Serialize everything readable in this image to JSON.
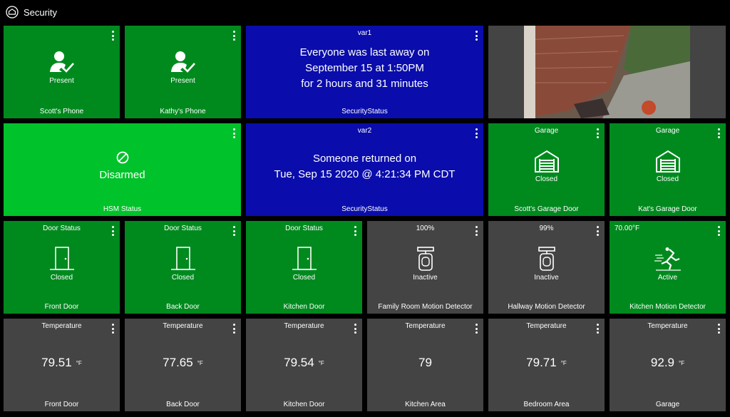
{
  "header": {
    "title": "Security",
    "icon": "home-icon"
  },
  "colors": {
    "green": "#008a1e",
    "light_green": "#00c22a",
    "blue": "#0a0dab",
    "gray": "#444444",
    "background": "#000000"
  },
  "tiles": {
    "scotts_phone": {
      "state": "Present",
      "label": "Scott's Phone",
      "icon": "person-check-icon"
    },
    "kathys_phone": {
      "state": "Present",
      "label": "Kathy's Phone",
      "icon": "person-check-icon"
    },
    "var1": {
      "top": "var1",
      "line1": "Everyone was last away on",
      "line2": "September 15 at 1:50PM",
      "line3": "for 2 hours and 31 minutes",
      "label": "SecurityStatus"
    },
    "hsm": {
      "state": "Disarmed",
      "label": "HSM Status",
      "icon": "disarmed-icon"
    },
    "var2": {
      "top": "var2",
      "line1": "Someone returned on",
      "line2": "Tue, Sep 15 2020 @ 4:21:34 PM CDT",
      "label": "SecurityStatus"
    },
    "scotts_garage": {
      "top": "Garage",
      "state": "Closed",
      "label": "Scott's Garage Door",
      "icon": "garage-icon"
    },
    "kats_garage": {
      "top": "Garage",
      "state": "Closed",
      "label": "Kat's Garage Door",
      "icon": "garage-icon"
    },
    "front_door": {
      "top": "Door Status",
      "state": "Closed",
      "label": "Front Door",
      "icon": "door-icon"
    },
    "back_door": {
      "top": "Door Status",
      "state": "Closed",
      "label": "Back Door",
      "icon": "door-icon"
    },
    "kitchen_door": {
      "top": "Door Status",
      "state": "Closed",
      "label": "Kitchen Door",
      "icon": "door-icon"
    },
    "family_motion": {
      "top": "100%",
      "state": "Inactive",
      "label": "Family Room Motion Detector",
      "icon": "motion-sensor-icon"
    },
    "hallway_motion": {
      "top": "99%",
      "state": "Inactive",
      "label": "Hallway Motion Detector",
      "icon": "motion-sensor-icon"
    },
    "kitchen_motion": {
      "top": "70.00°F",
      "state": "Active",
      "label": "Kitchen Motion Detector",
      "icon": "walking-icon"
    },
    "t_front": {
      "top": "Temperature",
      "value": "79.51",
      "unit": "°F",
      "label": "Front Door"
    },
    "t_back": {
      "top": "Temperature",
      "value": "77.65",
      "unit": "°F",
      "label": "Back Door"
    },
    "t_kitchen": {
      "top": "Temperature",
      "value": "79.54",
      "unit": "°F",
      "label": "Kitchen Door"
    },
    "t_kitchen_area": {
      "top": "Temperature",
      "value": "79",
      "label": "Kitchen Area"
    },
    "t_bedroom": {
      "top": "Temperature",
      "value": "79.71",
      "unit": "°F",
      "label": "Bedroom Area"
    },
    "t_garage": {
      "top": "Temperature",
      "value": "92.9",
      "unit": "°F",
      "label": "Garage"
    }
  }
}
